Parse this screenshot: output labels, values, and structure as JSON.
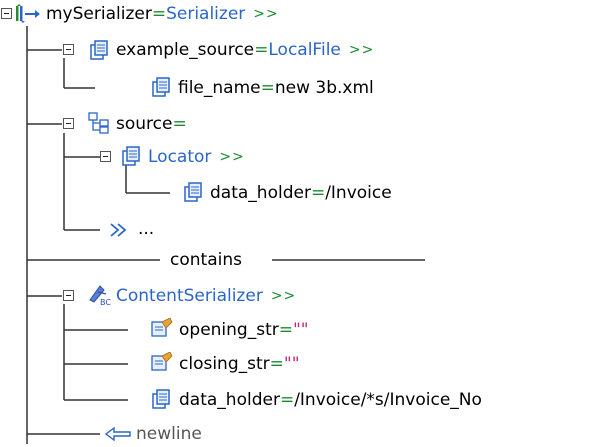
{
  "tree": {
    "root": {
      "name": "mySerializer",
      "sep": " = ",
      "value": "Serializer",
      "more": ">>"
    },
    "example_source": {
      "name": "example_source",
      "sep": " = ",
      "value": "LocalFile",
      "more": ">>"
    },
    "file_name": {
      "name": "file_name",
      "sep": " = ",
      "value": "new 3b.xml"
    },
    "source": {
      "name": "source",
      "sep": " ="
    },
    "locator": {
      "value": "Locator",
      "more": ">>"
    },
    "locator_data_holder": {
      "name": "data_holder",
      "sep": " = ",
      "value": "/Invoice"
    },
    "ellipsis": {
      "text": "..."
    },
    "contains": {
      "text": "contains"
    },
    "content_serializer": {
      "value": "ContentSerializer",
      "more": ">>"
    },
    "opening_str": {
      "name": "opening_str",
      "sep": " = ",
      "value": "\"\""
    },
    "closing_str": {
      "name": "closing_str",
      "sep": " = ",
      "value": "\"\""
    },
    "cs_data_holder": {
      "name": "data_holder",
      "sep": " = ",
      "value": "/Invoice/*s/Invoice_No"
    },
    "newline": {
      "text": "newline"
    }
  },
  "colors": {
    "keyword": "#000000",
    "equals": "#1b8a2f",
    "type_link": "#2a66c8",
    "string_value": "#c02a7a",
    "tree_lines": "#333333"
  },
  "icons": {
    "root": "serializer-flow-icon",
    "property": "property-icon",
    "source": "source-tree-icon",
    "content_serializer": "content-serializer-icon",
    "string_property": "string-property-icon",
    "more_children": "double-chevron-icon",
    "newline": "newline-arrow-icon",
    "expander": "collapse-minus-icon"
  }
}
